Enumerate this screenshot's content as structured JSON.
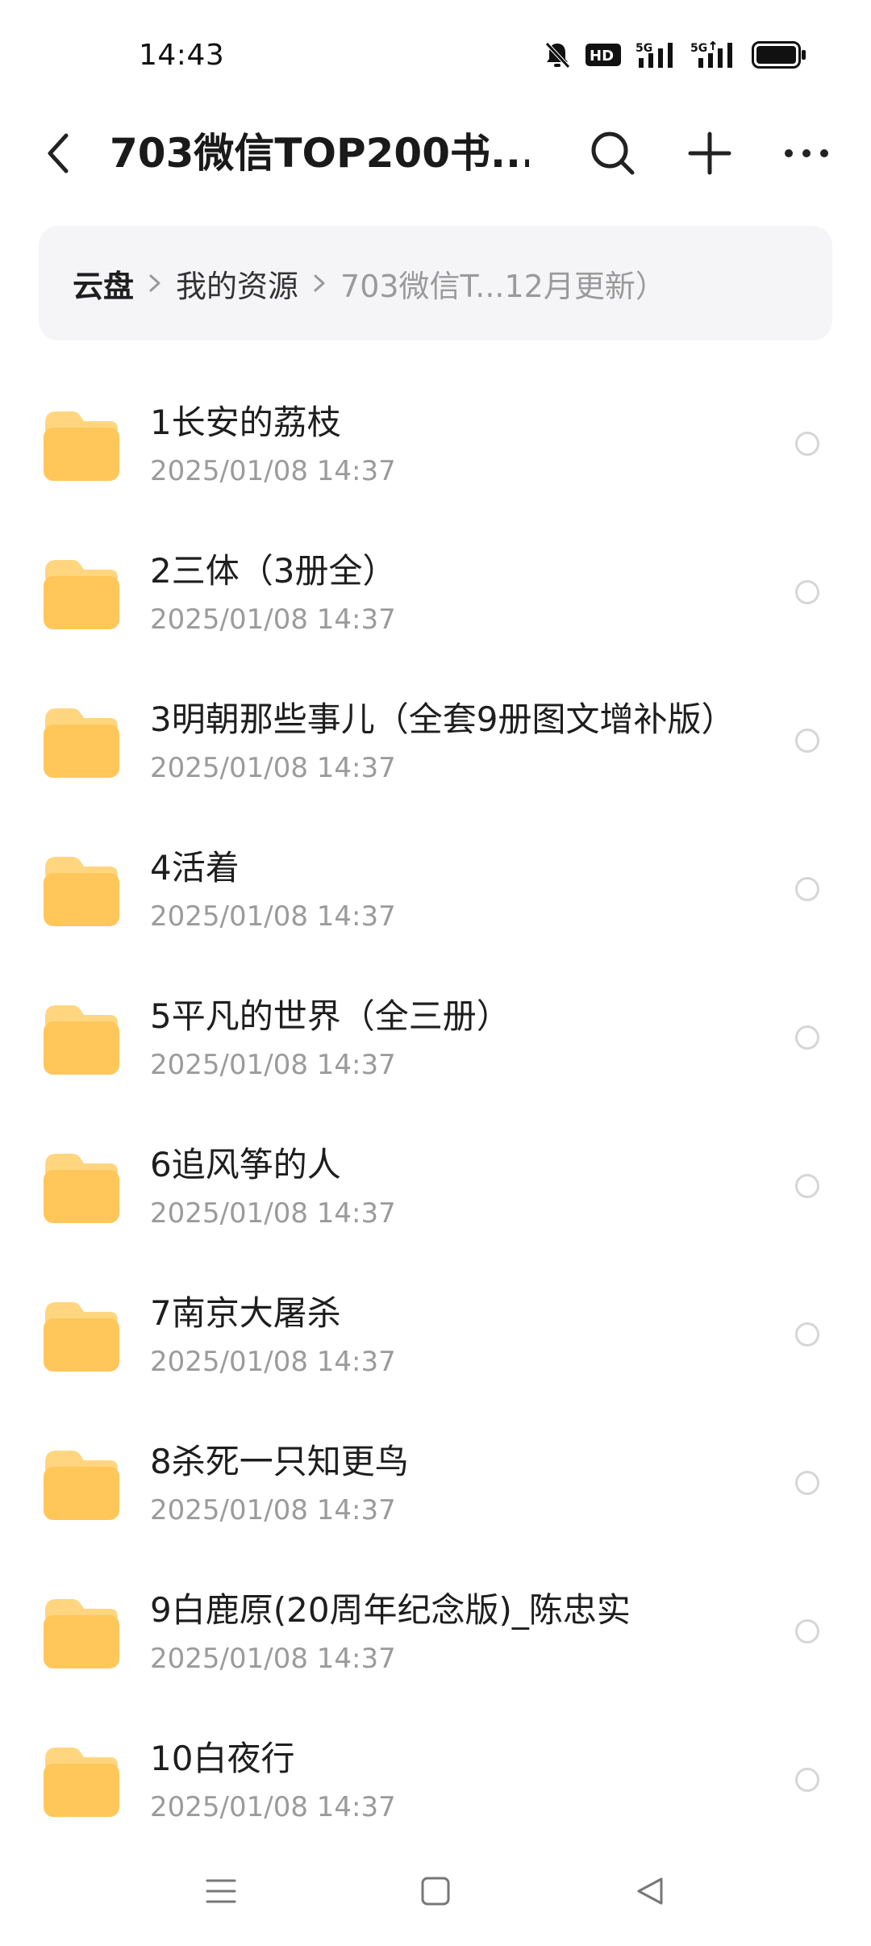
{
  "status_bar": {
    "time": "14:43",
    "icons": [
      "mute-bell-icon",
      "hd-icon",
      "signal-5g-icon",
      "signal-5g-icon",
      "battery-icon"
    ],
    "hd_label": "HD",
    "network_label_1": "5G",
    "network_label_2": "5G"
  },
  "header": {
    "title": "703微信TOP200书...",
    "icons": {
      "back": "back-arrow-icon",
      "search": "search-icon",
      "add": "plus-icon",
      "more": "more-icon"
    }
  },
  "breadcrumb": {
    "items": [
      "云盘",
      "我的资源",
      "703微信T...12月更新）"
    ]
  },
  "files": [
    {
      "name": "1长安的荔枝",
      "date": "2025/01/08 14:37"
    },
    {
      "name": "2三体（3册全）",
      "date": "2025/01/08 14:37"
    },
    {
      "name": "3明朝那些事儿（全套9册图文增补版）",
      "date": "2025/01/08 14:37"
    },
    {
      "name": "4活着",
      "date": "2025/01/08 14:37"
    },
    {
      "name": "5平凡的世界（全三册）",
      "date": "2025/01/08 14:37"
    },
    {
      "name": "6追风筝的人",
      "date": "2025/01/08 14:37"
    },
    {
      "name": "7南京大屠杀",
      "date": "2025/01/08 14:37"
    },
    {
      "name": "8杀死一只知更鸟",
      "date": "2025/01/08 14:37"
    },
    {
      "name": "9白鹿原(20周年纪念版)_陈忠实",
      "date": "2025/01/08 14:37"
    },
    {
      "name": "10白夜行",
      "date": "2025/01/08 14:37"
    }
  ],
  "nav_bar": {
    "icons": [
      "menu-icon",
      "home-square-icon",
      "back-triangle-icon"
    ]
  },
  "colors": {
    "folder": "#ffc65a",
    "folder_tab": "#ffd67f",
    "breadcrumb_bg": "#f5f5f7",
    "secondary_text": "#9b9b9b"
  }
}
